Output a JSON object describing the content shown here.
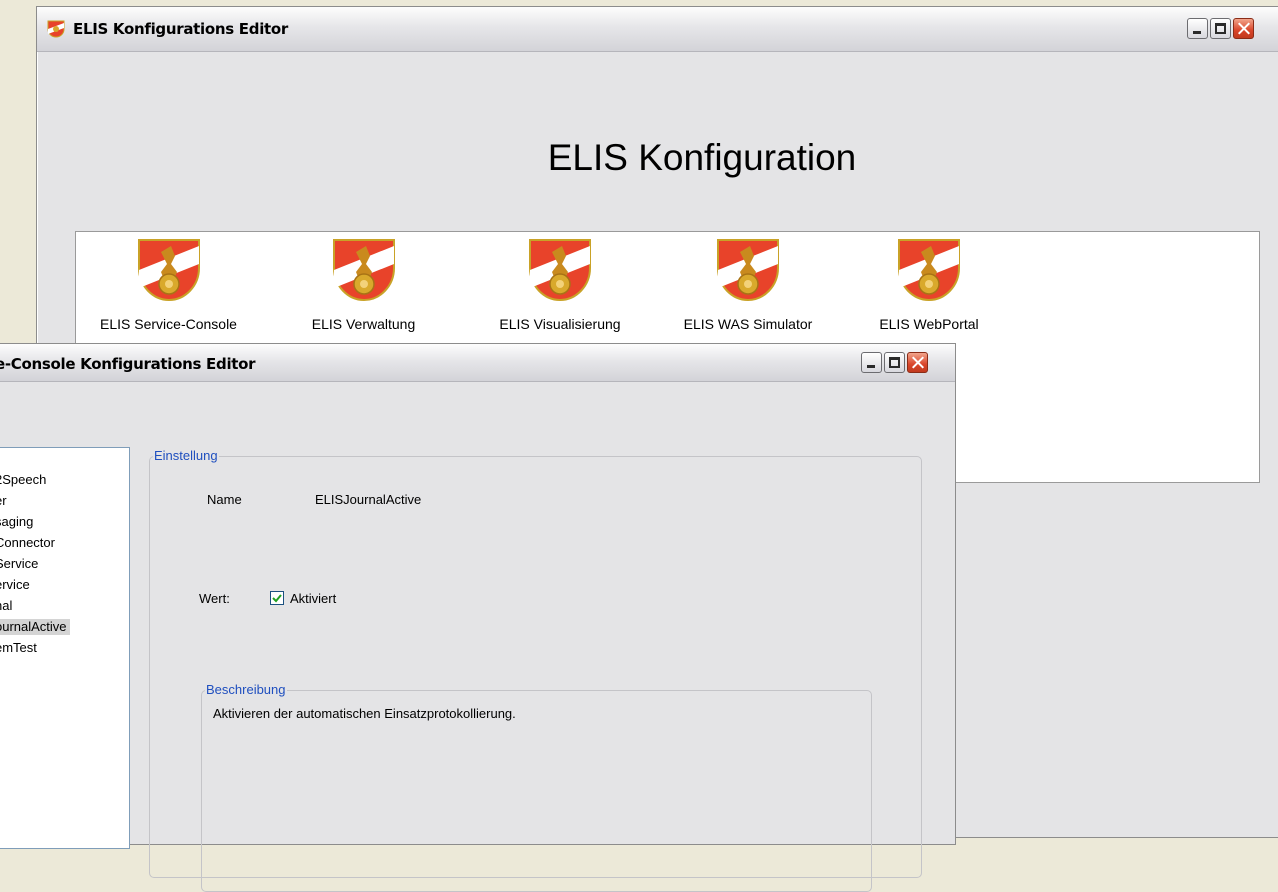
{
  "main_window": {
    "title": "ELIS Konfigurations Editor",
    "heading": "ELIS Konfiguration",
    "apps": [
      {
        "label": "ELIS Service-Console"
      },
      {
        "label": "ELIS Verwaltung"
      },
      {
        "label": "ELIS Visualisierung"
      },
      {
        "label": "ELIS WAS Simulator"
      },
      {
        "label": "ELIS WebPortal"
      }
    ]
  },
  "sub_window": {
    "title": "e-Console Konfigurations Editor",
    "tree_items": [
      {
        "label": "2Speech"
      },
      {
        "label": "er"
      },
      {
        "label": "saging"
      },
      {
        "label": "Connector"
      },
      {
        "label": "Service"
      },
      {
        "label": "ervice"
      },
      {
        "label": "nal"
      },
      {
        "label": "ournalActive",
        "selected": true
      },
      {
        "label": "emTest"
      }
    ],
    "settings": {
      "group_title": "Einstellung",
      "name_label": "Name",
      "name_value": "ELISJournalActive",
      "value_label": "Wert:",
      "checkbox_label": "Aktiviert",
      "checkbox_checked": true,
      "description_title": "Beschreibung",
      "description_text": "Aktivieren der automatischen Einsatzprotokollierung."
    }
  },
  "colors": {
    "window_bg": "#E4E4E6",
    "group_title": "#1f4fbf",
    "close_button": "#d9452a"
  }
}
